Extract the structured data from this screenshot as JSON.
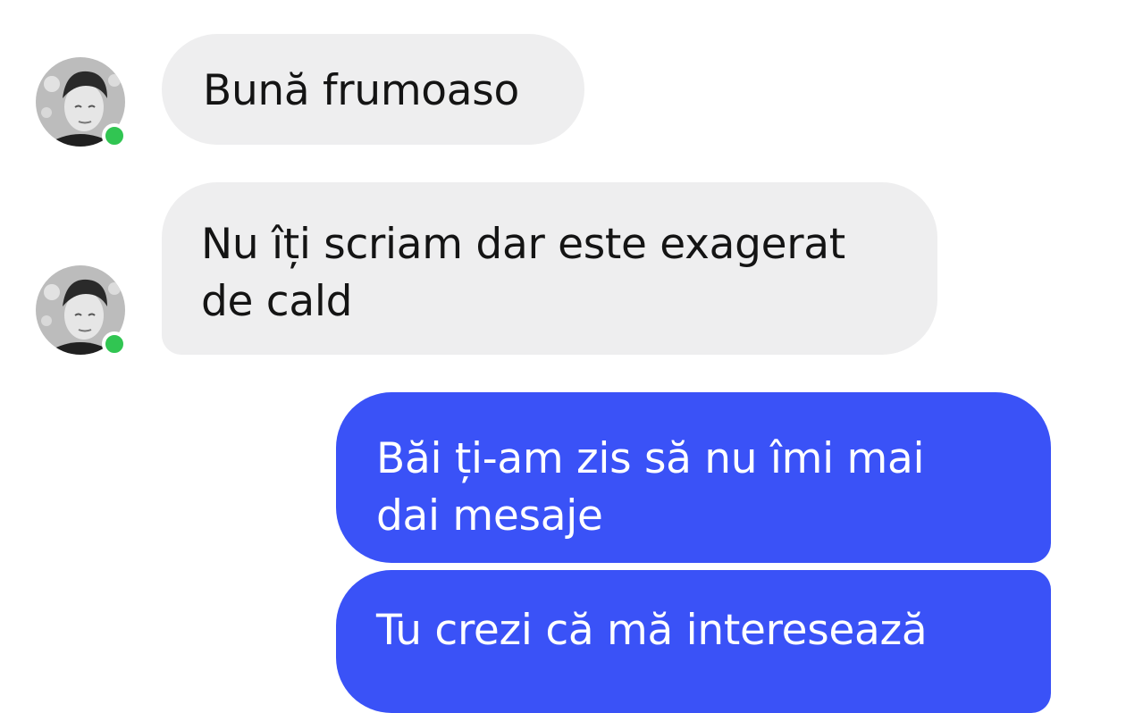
{
  "colors": {
    "incoming_bubble": "#eeeeef",
    "outgoing_bubble": "#3a52f7",
    "online_indicator": "#31c552"
  },
  "messages": [
    {
      "direction": "incoming",
      "lines": [
        "Bună frumoaso"
      ],
      "show_avatar": true
    },
    {
      "direction": "incoming",
      "lines": [
        "Nu îți scriam dar este exagerat",
        "de cald"
      ],
      "show_avatar": true
    },
    {
      "direction": "outgoing",
      "lines": [
        "Băi ți-am zis să nu îmi mai",
        "dai mesaje"
      ],
      "show_avatar": false
    },
    {
      "direction": "outgoing",
      "lines": [
        "Tu crezi că mă interesează"
      ],
      "show_avatar": false
    }
  ],
  "contact": {
    "avatar_icon": "user-photo",
    "status": "online"
  }
}
